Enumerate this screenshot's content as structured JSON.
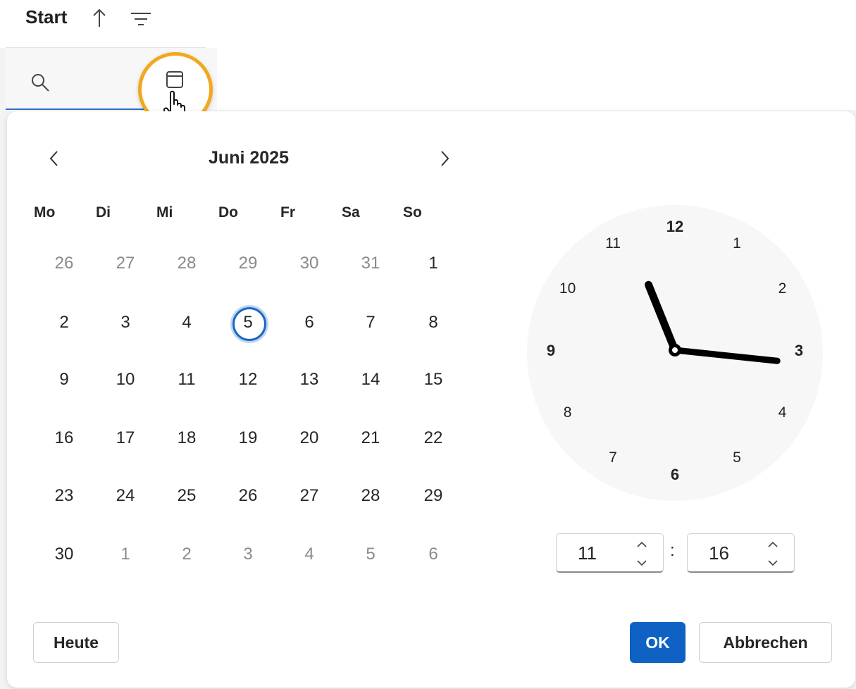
{
  "column": {
    "title": "Start",
    "sort_icon": "arrow-up-icon",
    "filter_icon": "filter-lines-icon"
  },
  "filter_row": {
    "search_icon": "search-icon",
    "calendar_icon": "calendar-icon",
    "cursor_icon": "hand-pointer-icon",
    "highlight_color": "#f2a81d",
    "underline_color": "#2f6fc9"
  },
  "calendar": {
    "month_title": "Juni 2025",
    "prev_icon": "chevron-left-icon",
    "next_icon": "chevron-right-icon",
    "weekdays": [
      "Mo",
      "Di",
      "Mi",
      "Do",
      "Fr",
      "Sa",
      "So"
    ],
    "weeks": [
      [
        {
          "d": "26",
          "m": true
        },
        {
          "d": "27",
          "m": true
        },
        {
          "d": "28",
          "m": true
        },
        {
          "d": "29",
          "m": true
        },
        {
          "d": "30",
          "m": true
        },
        {
          "d": "31",
          "m": true
        },
        {
          "d": "1",
          "m": false
        }
      ],
      [
        {
          "d": "2",
          "m": false
        },
        {
          "d": "3",
          "m": false
        },
        {
          "d": "4",
          "m": false
        },
        {
          "d": "5",
          "m": false,
          "s": true
        },
        {
          "d": "6",
          "m": false
        },
        {
          "d": "7",
          "m": false
        },
        {
          "d": "8",
          "m": false
        }
      ],
      [
        {
          "d": "9",
          "m": false
        },
        {
          "d": "10",
          "m": false
        },
        {
          "d": "11",
          "m": false
        },
        {
          "d": "12",
          "m": false
        },
        {
          "d": "13",
          "m": false
        },
        {
          "d": "14",
          "m": false
        },
        {
          "d": "15",
          "m": false
        }
      ],
      [
        {
          "d": "16",
          "m": false
        },
        {
          "d": "17",
          "m": false
        },
        {
          "d": "18",
          "m": false
        },
        {
          "d": "19",
          "m": false
        },
        {
          "d": "20",
          "m": false
        },
        {
          "d": "21",
          "m": false
        },
        {
          "d": "22",
          "m": false
        }
      ],
      [
        {
          "d": "23",
          "m": false
        },
        {
          "d": "24",
          "m": false
        },
        {
          "d": "25",
          "m": false
        },
        {
          "d": "26",
          "m": false
        },
        {
          "d": "27",
          "m": false
        },
        {
          "d": "28",
          "m": false
        },
        {
          "d": "29",
          "m": false
        }
      ],
      [
        {
          "d": "30",
          "m": false
        },
        {
          "d": "1",
          "m": true
        },
        {
          "d": "2",
          "m": true
        },
        {
          "d": "3",
          "m": true
        },
        {
          "d": "4",
          "m": true
        },
        {
          "d": "5",
          "m": true
        },
        {
          "d": "6",
          "m": true
        }
      ]
    ],
    "selected_color": "#1a66c7"
  },
  "clock": {
    "numbers": [
      "12",
      "1",
      "2",
      "3",
      "4",
      "5",
      "6",
      "7",
      "8",
      "9",
      "10",
      "11"
    ],
    "bold_numbers": [
      "12",
      "3",
      "6",
      "9"
    ],
    "hour": 11,
    "minute": 16
  },
  "time": {
    "hour": "11",
    "separator": ":",
    "minute": "16",
    "up_icon": "chevron-up-icon",
    "down_icon": "chevron-down-icon"
  },
  "buttons": {
    "today": "Heute",
    "ok": "OK",
    "cancel": "Abbrechen",
    "ok_color": "#0f61c3"
  }
}
